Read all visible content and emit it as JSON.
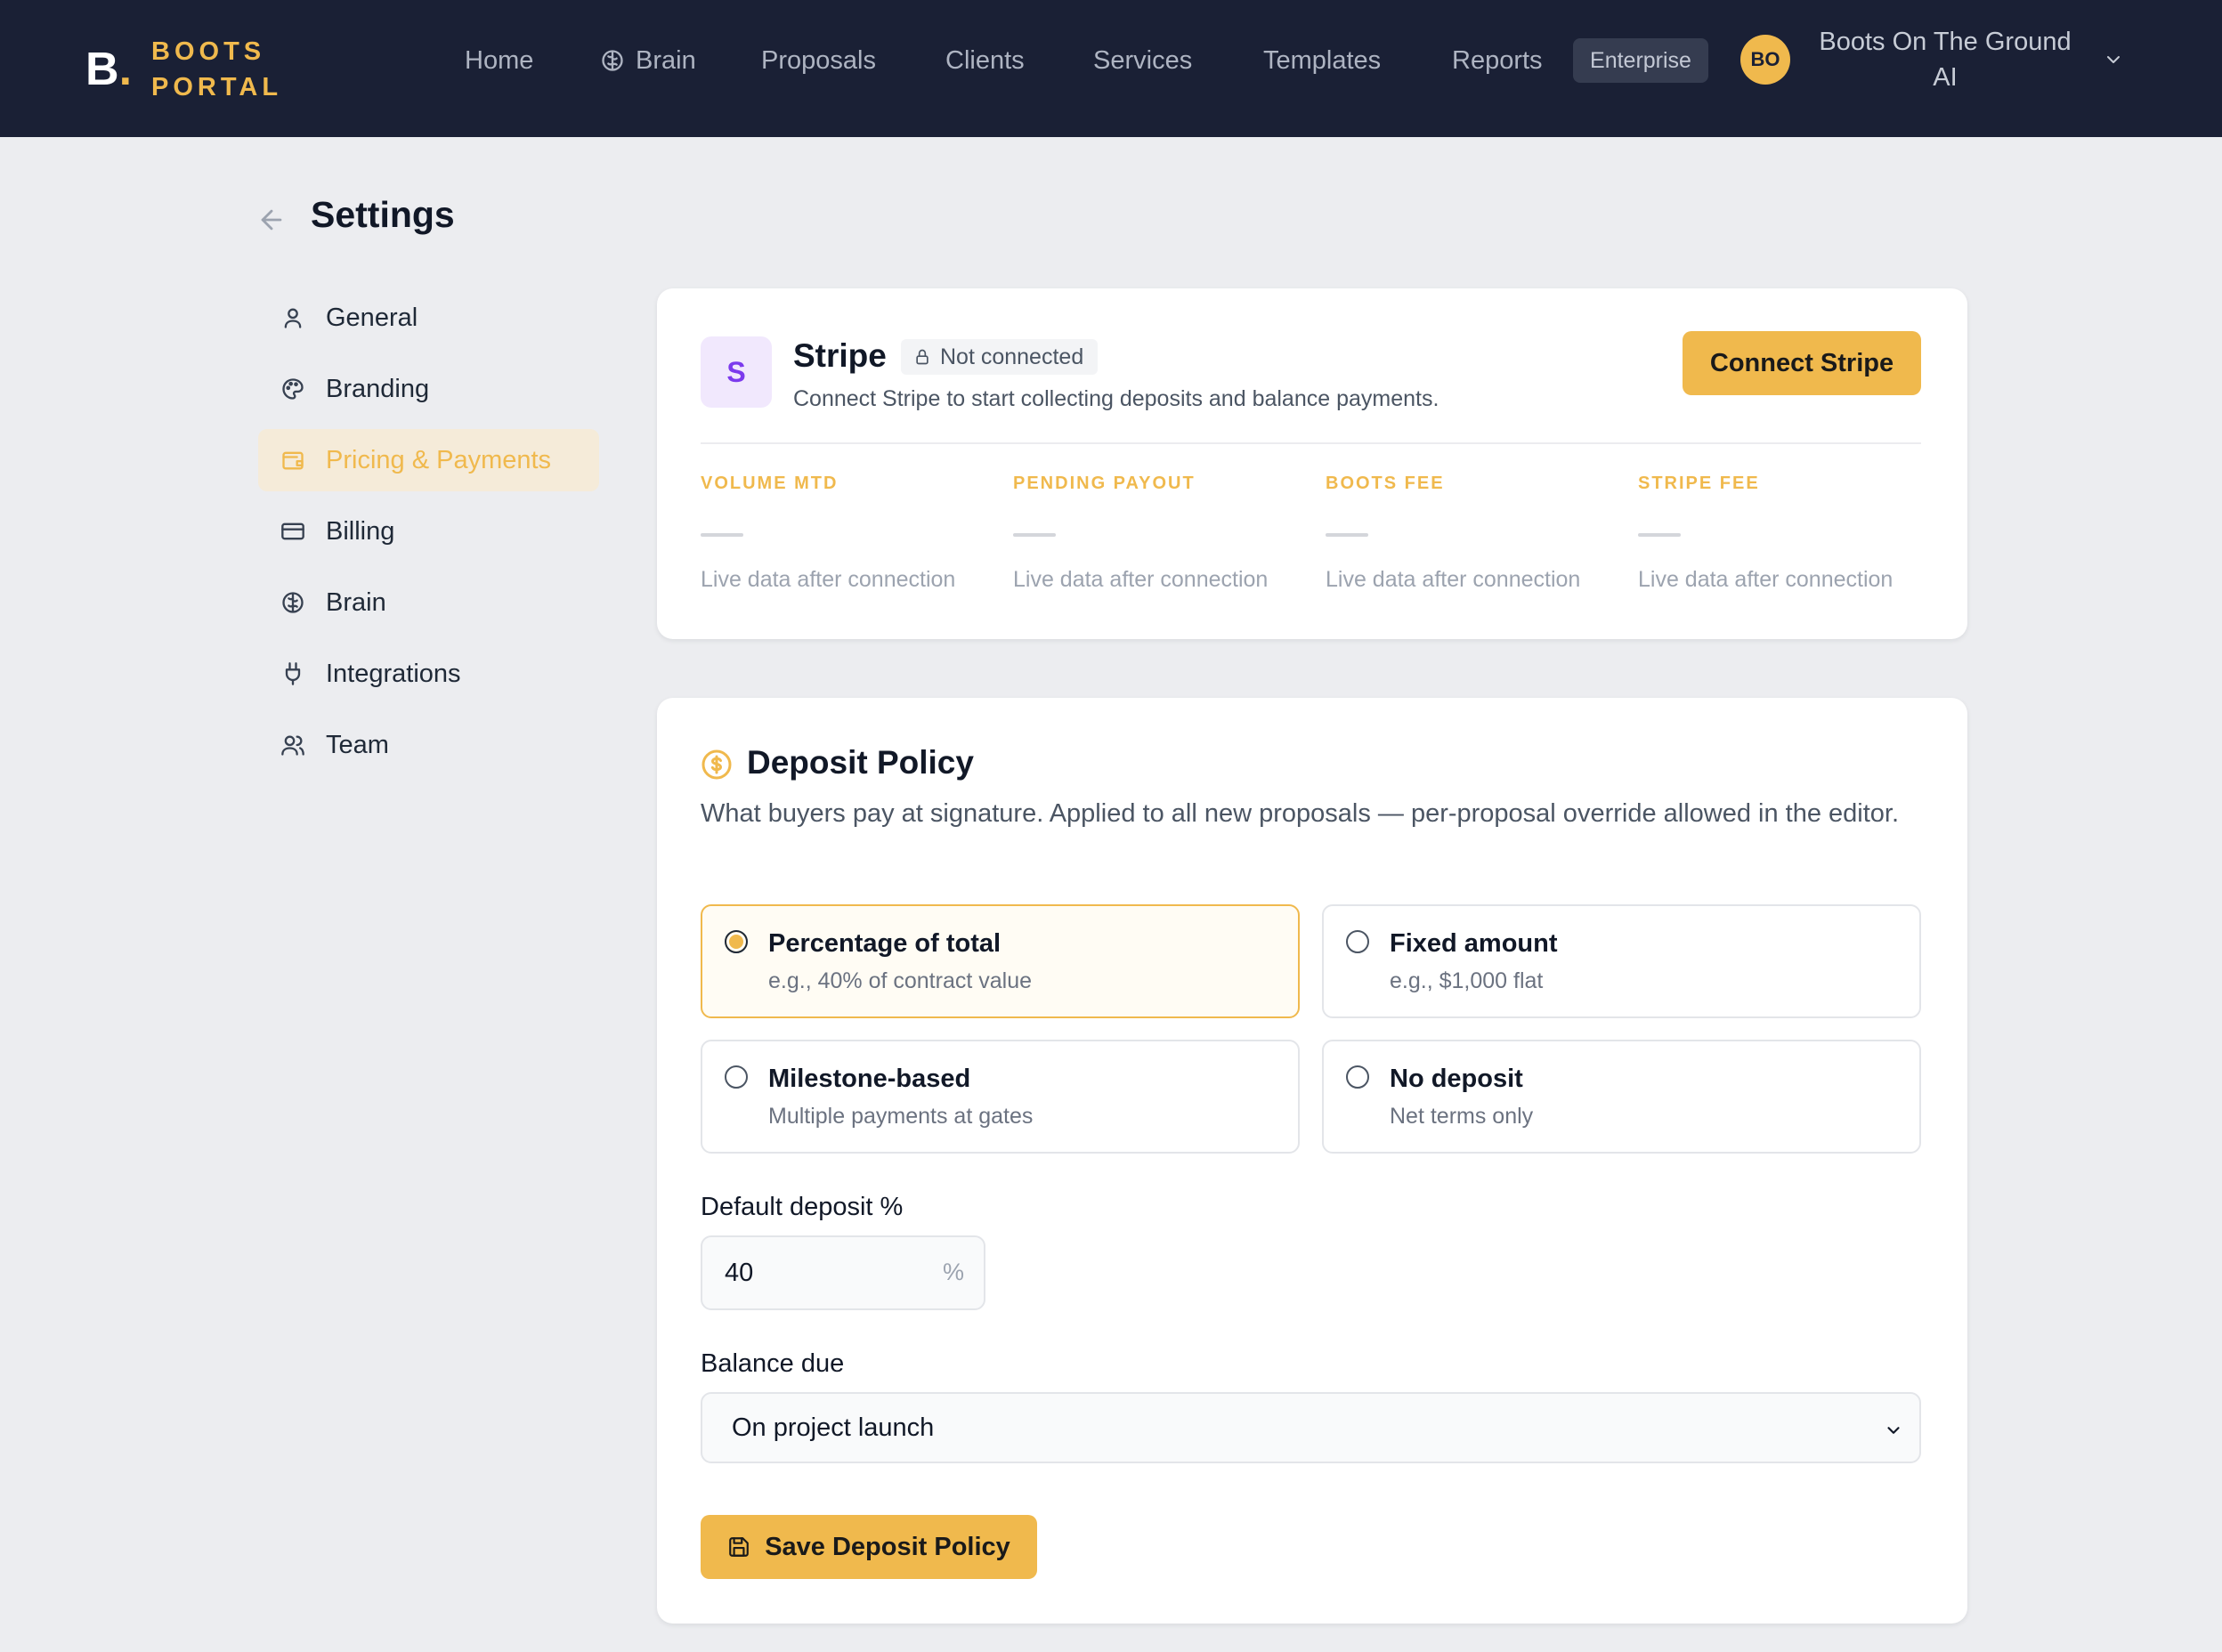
{
  "brand": {
    "mark": "B",
    "name_line1": "BOOTS",
    "name_line2": "PORTAL"
  },
  "nav": {
    "items": [
      {
        "label": "Home"
      },
      {
        "label": "Brain"
      },
      {
        "label": "Proposals"
      },
      {
        "label": "Clients"
      },
      {
        "label": "Services"
      },
      {
        "label": "Templates"
      },
      {
        "label": "Reports"
      }
    ],
    "plan_badge": "Enterprise",
    "avatar_initials": "BO",
    "account_name": "Boots On The Ground AI"
  },
  "page": {
    "title": "Settings"
  },
  "sidebar": {
    "active": "Pricing & Payments",
    "items": [
      {
        "label": "General",
        "icon": "user-icon"
      },
      {
        "label": "Branding",
        "icon": "palette-icon"
      },
      {
        "label": "Pricing & Payments",
        "icon": "wallet-icon"
      },
      {
        "label": "Billing",
        "icon": "credit-card-icon"
      },
      {
        "label": "Brain",
        "icon": "brain-icon"
      },
      {
        "label": "Integrations",
        "icon": "plug-icon"
      },
      {
        "label": "Team",
        "icon": "users-icon"
      }
    ]
  },
  "stripe": {
    "logo_letter": "S",
    "name": "Stripe",
    "status": "Not connected",
    "description": "Connect Stripe to start collecting deposits and balance payments.",
    "connect_label": "Connect Stripe",
    "metrics": [
      {
        "label": "VOLUME MTD",
        "note": "Live data after connection"
      },
      {
        "label": "PENDING PAYOUT",
        "note": "Live data after connection"
      },
      {
        "label": "BOOTS FEE",
        "note": "Live data after connection"
      },
      {
        "label": "STRIPE FEE",
        "note": "Live data after connection"
      }
    ]
  },
  "deposit": {
    "title": "Deposit Policy",
    "description": "What buyers pay at signature. Applied to all new proposals — per-proposal override allowed in the editor.",
    "options": [
      {
        "title": "Percentage of total",
        "subtitle": "e.g., 40% of contract value",
        "selected": true
      },
      {
        "title": "Fixed amount",
        "subtitle": "e.g., $1,000 flat",
        "selected": false
      },
      {
        "title": "Milestone-based",
        "subtitle": "Multiple payments at gates",
        "selected": false
      },
      {
        "title": "No deposit",
        "subtitle": "Net terms only",
        "selected": false
      }
    ],
    "default_pct_label": "Default deposit %",
    "default_pct_value": "40",
    "default_pct_suffix": "%",
    "balance_due_label": "Balance due",
    "balance_due_value": "On project launch",
    "save_label": "Save Deposit Policy"
  },
  "colors": {
    "nav_bg": "#1a2035",
    "accent": "#f0b94d",
    "page_bg": "#ecedf0",
    "stripe_purple": "#7c3aed"
  }
}
